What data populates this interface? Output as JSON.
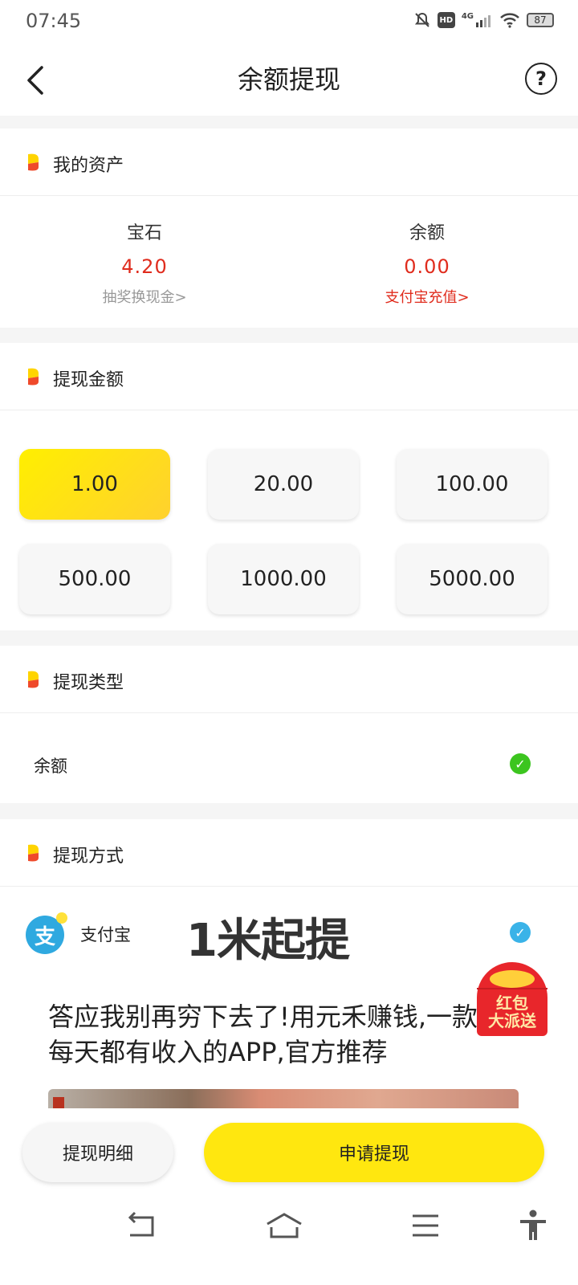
{
  "status_bar": {
    "time": "07:45",
    "network": "4G",
    "hd": "HD",
    "battery": "87"
  },
  "header": {
    "title": "余额提现",
    "help_symbol": "?"
  },
  "assets": {
    "title": "我的资产",
    "gem": {
      "label": "宝石",
      "value": "4.20",
      "link": "抽奖换现金>"
    },
    "balance": {
      "label": "余额",
      "value": "0.00",
      "link": "支付宝充值>"
    }
  },
  "amount": {
    "title": "提现金额",
    "options": [
      "1.00",
      "20.00",
      "100.00",
      "500.00",
      "1000.00",
      "5000.00"
    ],
    "selected": "1.00"
  },
  "type": {
    "title": "提现类型",
    "option": "余额",
    "checked": true
  },
  "method": {
    "title": "提现方式",
    "option": "支付宝",
    "logo_char": "支",
    "slogan": "1米起提",
    "checked": true
  },
  "ad": {
    "text_line1": "答应我别再穷下去了!用元禾赚钱,一款",
    "text_line2": "每天都有收入的APP,官方推荐",
    "badge_line1": "红包",
    "badge_line2": "大派送"
  },
  "bottom": {
    "detail_label": "提现明细",
    "apply_label": "申请提现"
  },
  "colors": {
    "accent_yellow": "#ffe70f",
    "value_red": "#e02c1d",
    "check_green": "#3cc51f",
    "check_blue": "#3ab3e8",
    "alipay_blue": "#2fa9e0"
  },
  "icons": {
    "back": "chevron-left-icon",
    "help": "question-circle-icon",
    "nav": [
      "back-nav-icon",
      "home-nav-icon",
      "menu-nav-icon",
      "accessibility-icon"
    ]
  }
}
